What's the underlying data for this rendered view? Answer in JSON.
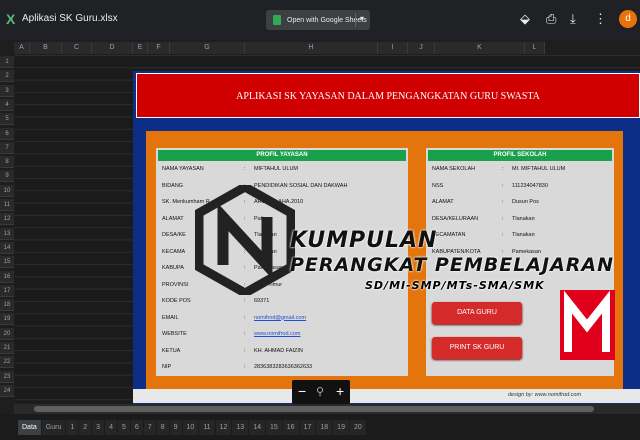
{
  "file_title": "Aplikasi SK Guru.xlsx",
  "open_with": "Open with Google Sheets",
  "avatar_letter": "d",
  "columns": [
    "A",
    "B",
    "C",
    "D",
    "E",
    "F",
    "G",
    "H",
    "I",
    "J",
    "K",
    "L"
  ],
  "rows": [
    "1",
    "2",
    "3",
    "4",
    "5",
    "6",
    "7",
    "8",
    "9",
    "10",
    "11",
    "12",
    "13",
    "14",
    "15",
    "16",
    "17",
    "18",
    "19",
    "20",
    "21",
    "22",
    "23",
    "24"
  ],
  "banner": "APLIKASI SK YAYASAN DALAM PENGANGKATAN GURU SWASTA",
  "yayasan": {
    "title": "PROFIL YAYASAN",
    "rows": [
      {
        "l": "NAMA YAYASAN",
        "v": "MIFTAHUL ULUM"
      },
      {
        "l": "BIDANG",
        "v": "PENDIDIKAN SOSIAL DAN DAKWAH"
      },
      {
        "l": "SK. Menkumham R",
        "v": "AHU-000.AHA.2010"
      },
      {
        "l": "ALAMAT",
        "v": "Pati"
      },
      {
        "l": "DESA/KE",
        "v": "Tlanakan"
      },
      {
        "l": "KECAMA",
        "v": "Tlanakan"
      },
      {
        "l": "KABUPA",
        "v": "Pamekasan"
      },
      {
        "l": "PROVINSI",
        "v": "Jawa Timur"
      },
      {
        "l": "KODE POS",
        "v": "69371"
      },
      {
        "l": "EMAIL",
        "v": "nomifrod@gmail.com"
      },
      {
        "l": "WEBSITE",
        "v": "www.nomifrod.com"
      },
      {
        "l": "KETUA",
        "v": "KH. AHMAD FAIZIN"
      },
      {
        "l": "NIP",
        "v": "2836383283636362633"
      }
    ]
  },
  "sekolah": {
    "title": "PROFIL SEKOLAH",
    "rows": [
      {
        "l": "NAMA SEKOLAH",
        "v": "MI. MIFTAHUL ULUM"
      },
      {
        "l": "NSS",
        "v": "111234047830"
      },
      {
        "l": "ALAMAT",
        "v": "Dusun Pos"
      },
      {
        "l": "DESA/KELURAAN",
        "v": "Tlanakan"
      },
      {
        "l": "KECAMATAN",
        "v": "Tlanakan"
      },
      {
        "l": "KABUPATEN/KOTA",
        "v": "Pamekasan"
      }
    ]
  },
  "buttons": {
    "data_guru": "DATA GURU",
    "print_sk": "PRINT SK GURU"
  },
  "credit": "design by: www.nomifrod.com",
  "watermark": {
    "line1": "KUMPULAN",
    "line2": "PERANGKAT PEMBELAJARAN",
    "line3": "SD/MI-SMP/MTs-SMA/SMK"
  },
  "zoom": {
    "minus": "−",
    "plus": "+"
  },
  "tabs": [
    "Data",
    "Guru",
    "1",
    "2",
    "3",
    "4",
    "5",
    "6",
    "7",
    "8",
    "9",
    "10",
    "11",
    "12",
    "13",
    "14",
    "15",
    "16",
    "17",
    "18",
    "19",
    "20"
  ]
}
